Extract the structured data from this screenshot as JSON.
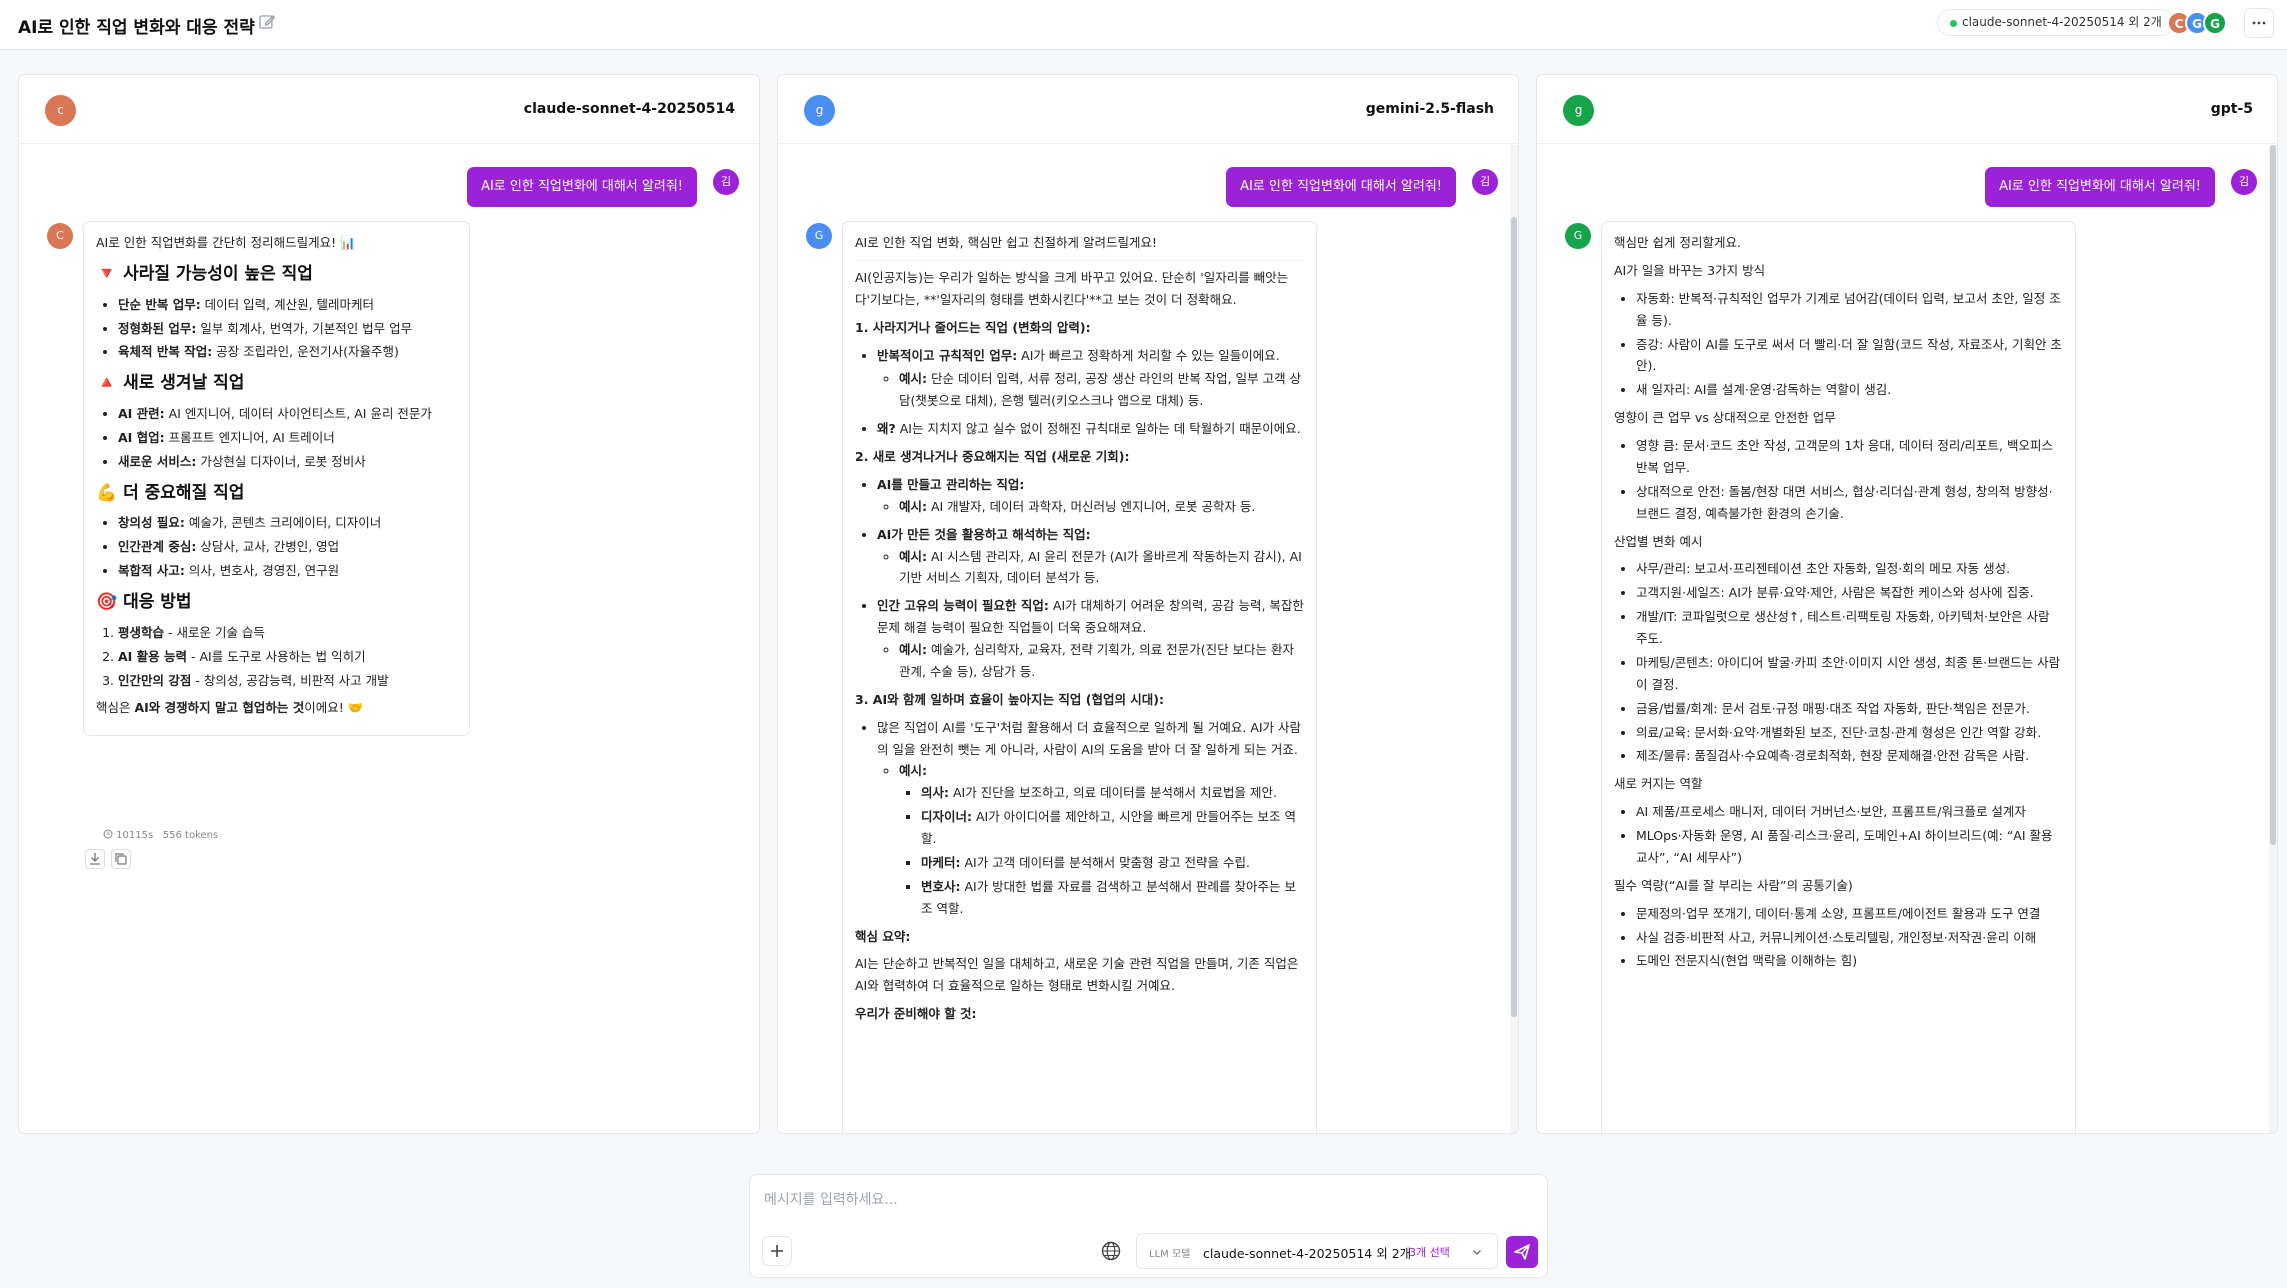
{
  "header": {
    "title": "AI로 인한 직업 변화와 대응 전략",
    "model_chip": "claude-sonnet-4-20250514 외 2개",
    "avatars": [
      {
        "letter": "C",
        "color": "#d97757"
      },
      {
        "letter": "G",
        "color": "#4b8ef1"
      },
      {
        "letter": "G",
        "color": "#16a34a"
      }
    ]
  },
  "colors": {
    "accent": "#9b22d6",
    "claude": "#d97757",
    "gemini": "#4b8ef1",
    "gpt": "#16a34a"
  },
  "panels": [
    {
      "avatar": "c",
      "model": "claude-sonnet-4-20250514",
      "user_message": "AI로 인한 직업변화에 대해서 알려줘!",
      "user_avatar": "김",
      "bot_avatar": "C",
      "intro": "AI로 인한 직업변화를 간단히 정리해드릴게요! 📊",
      "sections": [
        {
          "title": "🔻 사라질 가능성이 높은 직업",
          "items": [
            {
              "label": "단순 반복 업무:",
              "text": " 데이터 입력, 계산원, 텔레마케터"
            },
            {
              "label": "정형화된 업무:",
              "text": " 일부 회계사, 번역가, 기본적인 법무 업무"
            },
            {
              "label": "육체적 반복 작업:",
              "text": " 공장 조립라인, 운전기사(자율주행)"
            }
          ]
        },
        {
          "title": "🔺 새로 생겨날 직업",
          "items": [
            {
              "label": "AI 관련:",
              "text": " AI 엔지니어, 데이터 사이언티스트, AI 윤리 전문가"
            },
            {
              "label": "AI 협업:",
              "text": " 프롬프트 엔지니어, AI 트레이너"
            },
            {
              "label": "새로운 서비스:",
              "text": " 가상현실 디자이너, 로봇 정비사"
            }
          ]
        },
        {
          "title": "💪 더 중요해질 직업",
          "items": [
            {
              "label": "창의성 필요:",
              "text": " 예술가, 콘텐츠 크리에이터, 디자이너"
            },
            {
              "label": "인간관계 중심:",
              "text": " 상담사, 교사, 간병인, 영업"
            },
            {
              "label": "복합적 사고:",
              "text": " 의사, 변호사, 경영진, 연구원"
            }
          ]
        },
        {
          "title": "🎯 대응 방법",
          "items": [
            {
              "label": "평생학습",
              "text": " - 새로운 기술 습득"
            },
            {
              "label": "AI 활용 능력",
              "text": " - AI를 도구로 사용하는 법 익히기"
            },
            {
              "label": "인간만의 강점",
              "text": " - 창의성, 공감능력, 비판적 사고 개발"
            }
          ]
        }
      ],
      "outro_a": "핵심은 ",
      "outro_b": "AI와 경쟁하지 말고 협업하는 것",
      "outro_c": "이에요! 🤝",
      "meta_time": "10115s",
      "meta_tokens": "556 tokens"
    },
    {
      "avatar": "g",
      "model": "gemini-2.5-flash",
      "user_message": "AI로 인한 직업변화에 대해서 알려줘!",
      "user_avatar": "김",
      "bot_avatar": "G",
      "intro": "AI로 인한 직업 변화, 핵심만 쉽고 친절하게 알려드릴게요!",
      "p1": "AI(인공지능)는 우리가 일하는 방식을 크게 바꾸고 있어요. 단순히 '일자리를 빼앗는다'기보다는, **'일자리의 형태를 변화시킨다'**고 보는 것이 더 정확해요.",
      "h1": "1. 사라지거나 줄어드는 직업 (변화의 압력):",
      "s1": [
        {
          "label": "반복적이고 규칙적인 업무:",
          "text": " AI가 빠르고 정확하게 처리할 수 있는 일들이에요."
        },
        {
          "label": "예시:",
          "text": " 단순 데이터 입력, 서류 정리, 공장 생산 라인의 반복 작업, 일부 고객 상담(챗봇으로 대체), 은행 텔러(키오스크나 앱으로 대체) 등."
        },
        {
          "label": "왜?",
          "text": " AI는 지치지 않고 실수 없이 정해진 규칙대로 일하는 데 탁월하기 때문이에요."
        }
      ],
      "h2": "2. 새로 생겨나거나 중요해지는 직업 (새로운 기회):",
      "s2": [
        {
          "label": "AI를 만들고 관리하는 직업:",
          "text": ""
        },
        {
          "label": "예시:",
          "text": " AI 개발자, 데이터 과학자, 머신러닝 엔지니어, 로봇 공학자 등."
        },
        {
          "label": "AI가 만든 것을 활용하고 해석하는 직업:",
          "text": ""
        },
        {
          "label": "예시:",
          "text": " AI 시스템 관리자, AI 윤리 전문가 (AI가 올바르게 작동하는지 감시), AI 기반 서비스 기획자, 데이터 분석가 등."
        },
        {
          "label": "인간 고유의 능력이 필요한 직업:",
          "text": " AI가 대체하기 어려운 창의력, 공감 능력, 복잡한 문제 해결 능력이 필요한 직업들이 더욱 중요해져요."
        },
        {
          "label": "예시:",
          "text": " 예술가, 심리학자, 교육자, 전략 기획가, 의료 전문가(진단 보다는 환자 관계, 수술 등), 상담가 등."
        }
      ],
      "h3": "3. AI와 함께 일하며 효율이 높아지는 직업 (협업의 시대):",
      "s3_intro": "많은 직업이 AI를 '도구'처럼 활용해서 더 효율적으로 일하게 될 거예요. AI가 사람의 일을 완전히 뺏는 게 아니라, 사람이 AI의 도움을 받아 더 잘 일하게 되는 거죠.",
      "s3_ex": "예시:",
      "s3": [
        {
          "label": "의사:",
          "text": " AI가 진단을 보조하고, 의료 데이터를 분석해서 치료법을 제안."
        },
        {
          "label": "디자이너:",
          "text": " AI가 아이디어를 제안하고, 시안을 빠르게 만들어주는 보조 역할."
        },
        {
          "label": "마케터:",
          "text": " AI가 고객 데이터를 분석해서 맞춤형 광고 전략을 수립."
        },
        {
          "label": "변호사:",
          "text": " AI가 방대한 법률 자료를 검색하고 분석해서 판례를 찾아주는 보조 역할."
        }
      ],
      "summary_title": "핵심 요약:",
      "summary": "AI는 단순하고 반복적인 일을 대체하고, 새로운 기술 관련 직업을 만들며, 기존 직업은 AI와 협력하여 더 효율적으로 일하는 형태로 변화시킬 거예요.",
      "cut_line": "우리가 준비해야 할 것:"
    },
    {
      "avatar": "g",
      "model": "gpt-5",
      "user_message": "AI로 인한 직업변화에 대해서 알려줘!",
      "user_avatar": "김",
      "bot_avatar": "G",
      "intro": "핵심만 쉽게 정리할게요.",
      "groups": [
        {
          "title": "AI가 일을 바꾸는 3가지 방식",
          "items": [
            "자동화: 반복적·규칙적인 업무가 기계로 넘어감(데이터 입력, 보고서 초안, 일정 조율 등).",
            "증강: 사람이 AI를 도구로 써서 더 빨리·더 잘 일함(코드 작성, 자료조사, 기획안 초안).",
            "새 일자리: AI를 설계·운영·감독하는 역할이 생김."
          ]
        },
        {
          "title": "영향이 큰 업무 vs 상대적으로 안전한 업무",
          "items": [
            "영향 큼: 문서·코드 초안 작성, 고객문의 1차 응대, 데이터 정리/리포트, 백오피스 반복 업무.",
            "상대적으로 안전: 돌봄/현장 대면 서비스, 협상·리더십·관계 형성, 창의적 방향성·브랜드 결정, 예측불가한 환경의 손기술."
          ]
        },
        {
          "title": "산업별 변화 예시",
          "items": [
            "사무/관리: 보고서·프리젠테이션 초안 자동화, 일정·회의 메모 자동 생성.",
            "고객지원·세일즈: AI가 분류·요약·제안, 사람은 복잡한 케이스와 성사에 집중.",
            "개발/IT: 코파일럿으로 생산성↑, 테스트·리팩토링 자동화, 아키텍처·보안은 사람 주도.",
            "마케팅/콘텐츠: 아이디어 발굴·카피 초안·이미지 시안 생성, 최종 톤·브랜드는 사람이 결정.",
            "금융/법률/회계: 문서 검토·규정 매핑·대조 작업 자동화, 판단·책임은 전문가.",
            "의료/교육: 문서화·요약·개별화된 보조, 진단·코칭·관계 형성은 인간 역할 강화.",
            "제조/물류: 품질검사·수요예측·경로최적화, 현장 문제해결·안전 감독은 사람."
          ]
        },
        {
          "title": "새로 커지는 역할",
          "items": [
            "AI 제품/프로세스 매니저, 데이터 거버넌스·보안, 프롬프트/워크플로 설계자",
            "MLOps·자동화 운영, AI 품질·리스크·윤리, 도메인+AI 하이브리드(예: “AI 활용 교사”, “AI 세무사”)"
          ]
        },
        {
          "title": "필수 역량(“AI를 잘 부리는 사람”의 공통기술)",
          "items": [
            "문제정의·업무 쪼개기, 데이터·통계 소양, 프롬프트/에이전트 활용과 도구 연결",
            "사실 검증·비판적 사고, 커뮤니케이션·스토리텔링, 개인정보·저작권·윤리 이해",
            "도메인 전문지식(현업 맥락을 이해하는 힘)"
          ]
        }
      ]
    }
  ],
  "composer": {
    "placeholder": "메시지를 입력하세요...",
    "llm_label": "LLM 모델",
    "llm_value": "claude-sonnet-4-20250514 외 2개",
    "llm_count": "3개 선택"
  }
}
